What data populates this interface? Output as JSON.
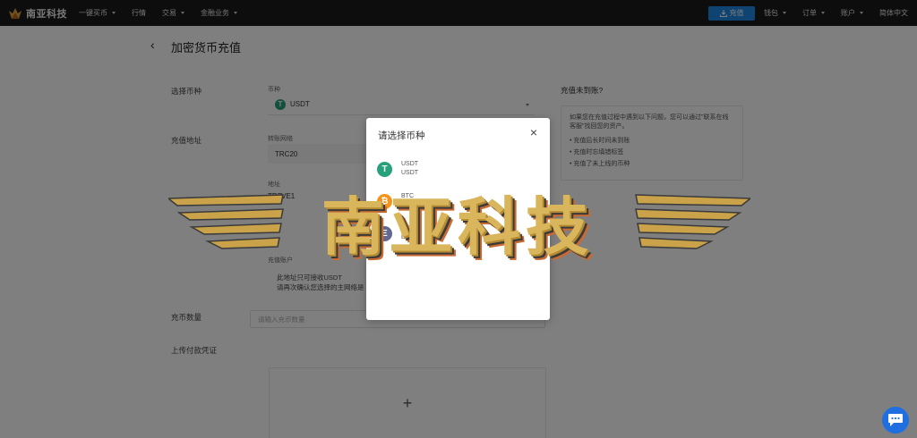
{
  "nav": {
    "brand_name": "南亚科技",
    "items": [
      "一键买币",
      "行情",
      "交易",
      "金融业务"
    ],
    "recharge_label": "充值",
    "right_items": [
      "钱包",
      "订单",
      "账户"
    ],
    "language": "简体中文"
  },
  "page": {
    "title": "加密货币充值",
    "labels": {
      "select_coin": "选择币种",
      "deposit_address": "充值地址",
      "amount": "充币数量",
      "upload_proof": "上传付款凭证"
    },
    "coin_field_label": "币种",
    "selected_coin": "USDT",
    "network_label": "转账网络",
    "network_value": "TRC20",
    "address_label": "地址",
    "address_value": "TR7VE1",
    "receive_account_label": "充值账户",
    "note_line1": "此地址只可接收USDT",
    "note_line2": "请再次确认您选择的主网络是",
    "amount_placeholder": "请输入充币数量",
    "upload_plus": "+"
  },
  "help": {
    "title": "充值未到账?",
    "description": "如果您在充值过程中遇到以下问题，您可以通过\"联系在线客服\"找回您的资产。",
    "items": [
      "充值后长时间未到账",
      "充值时忘填错标签",
      "充值了未上线的币种"
    ]
  },
  "modal": {
    "title": "请选择币种",
    "close": "×",
    "coins": [
      {
        "symbol": "USDT",
        "name": "USDT",
        "icon": "tether-icon",
        "color": "#26a17b",
        "glyph": "T"
      },
      {
        "symbol": "BTC",
        "name": "BTC",
        "icon": "bitcoin-icon",
        "color": "#f7931a",
        "glyph": "₿"
      },
      {
        "symbol": "ETH",
        "name": "ETH",
        "icon": "ethereum-icon",
        "color": "#62688f",
        "glyph": "Ξ"
      }
    ]
  },
  "watermark": {
    "text": "南亚科技"
  },
  "colors": {
    "accent": "#1e88e5",
    "navbar": "#1a1a1a",
    "tether": "#26a17b",
    "chat": "#1f6fe0"
  }
}
